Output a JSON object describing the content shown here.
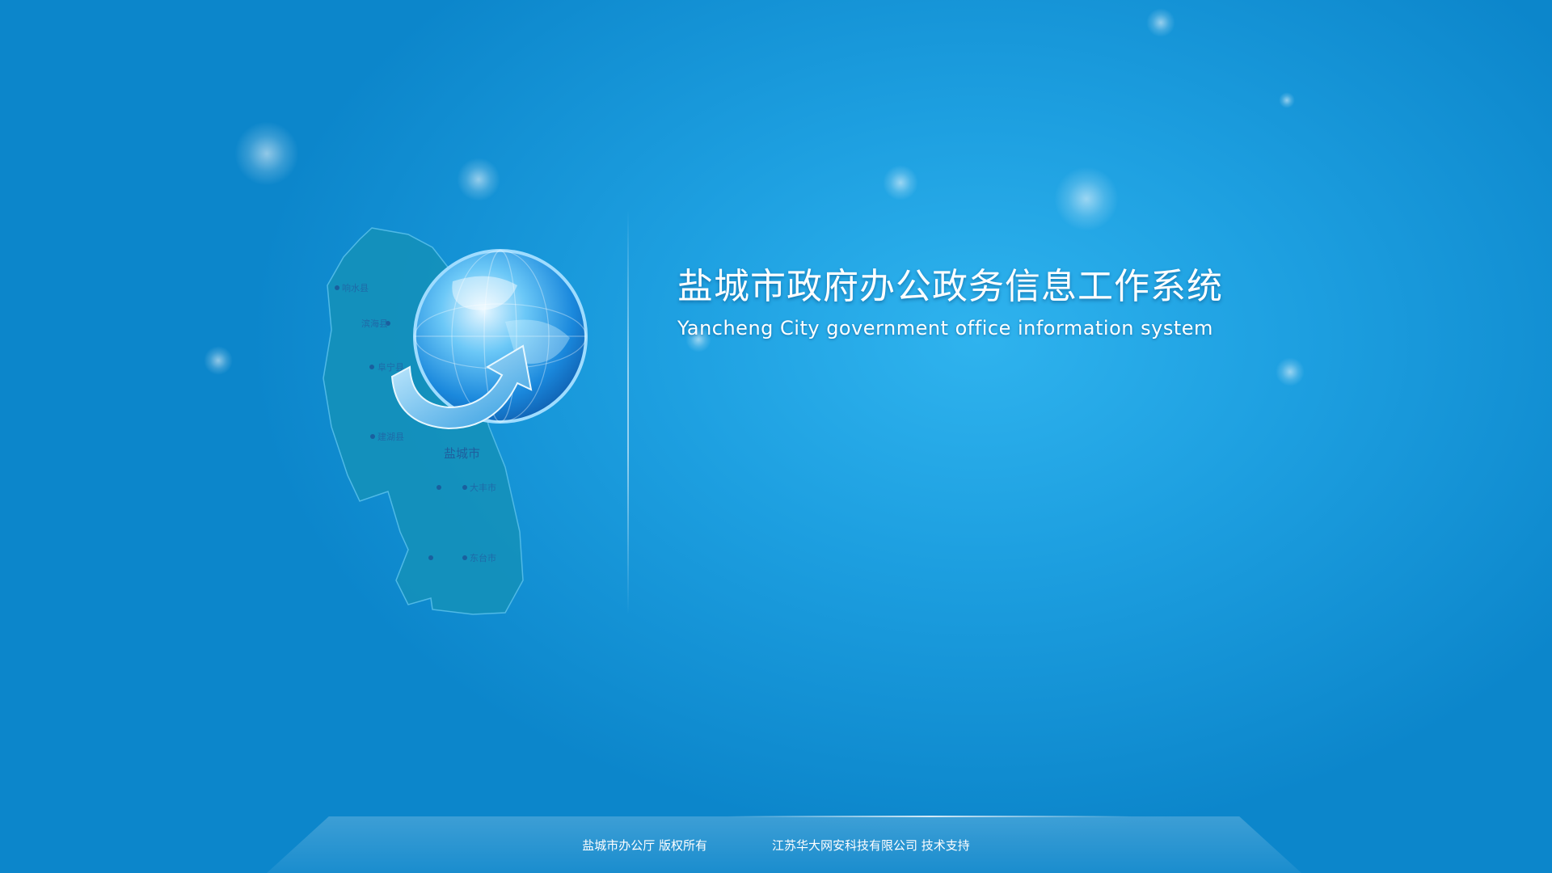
{
  "title": {
    "chinese": "盐城市政府办公政务信息工作系统",
    "english": "Yancheng City government office information system"
  },
  "map": {
    "labels": [
      "响水县",
      "滨海县",
      "阜宁县",
      "建湖县",
      "盐城市",
      "大丰市",
      "东台市"
    ]
  },
  "footer": {
    "copyright": "盐城市办公厅  版权所有",
    "support": "江苏华大网安科技有限公司  技术支持"
  },
  "colors": {
    "background": "#1d9fe0",
    "background_dark": "#0c86cb",
    "text": "#ffffff",
    "map_fill": "#1490b8"
  }
}
